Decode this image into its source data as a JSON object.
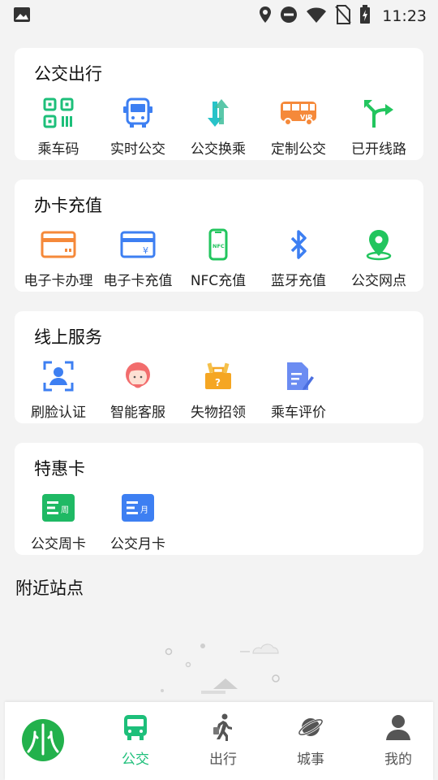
{
  "status_bar": {
    "time": "11:23"
  },
  "sections": [
    {
      "title": "公交出行",
      "items": [
        {
          "label": "乘车码",
          "icon": "qr-code-icon"
        },
        {
          "label": "实时公交",
          "icon": "bus-icon"
        },
        {
          "label": "公交换乘",
          "icon": "transfer-arrows-icon"
        },
        {
          "label": "定制公交",
          "icon": "vip-bus-icon"
        },
        {
          "label": "已开线路",
          "icon": "route-fork-icon"
        }
      ]
    },
    {
      "title": "办卡充值",
      "items": [
        {
          "label": "电子卡办理",
          "icon": "card-icon"
        },
        {
          "label": "电子卡充值",
          "icon": "card-yen-icon"
        },
        {
          "label": "NFC充值",
          "icon": "nfc-phone-icon"
        },
        {
          "label": "蓝牙充值",
          "icon": "bluetooth-icon"
        },
        {
          "label": "公交网点",
          "icon": "location-pin-icon"
        }
      ]
    },
    {
      "title": "线上服务",
      "items": [
        {
          "label": "刷脸认证",
          "icon": "face-scan-icon"
        },
        {
          "label": "智能客服",
          "icon": "customer-service-icon"
        },
        {
          "label": "失物招领",
          "icon": "lost-found-icon"
        },
        {
          "label": "乘车评价",
          "icon": "review-edit-icon"
        }
      ]
    },
    {
      "title": "特惠卡",
      "items": [
        {
          "label": "公交周卡",
          "icon": "weekly-card-icon",
          "badge": "周"
        },
        {
          "label": "公交月卡",
          "icon": "monthly-card-icon",
          "badge": "月"
        }
      ]
    }
  ],
  "nearby": {
    "title": "附近站点"
  },
  "tabbar": {
    "tabs": [
      {
        "label": "公交",
        "icon": "bus-tab-icon",
        "active": true
      },
      {
        "label": "出行",
        "icon": "walking-person-icon",
        "active": false
      },
      {
        "label": "城事",
        "icon": "planet-icon",
        "active": false
      },
      {
        "label": "我的",
        "icon": "user-icon",
        "active": false
      }
    ]
  },
  "colors": {
    "accent": "#1dbf7a",
    "blue": "#3d7ff2",
    "orange": "#f5893a",
    "green": "#22c55e"
  }
}
